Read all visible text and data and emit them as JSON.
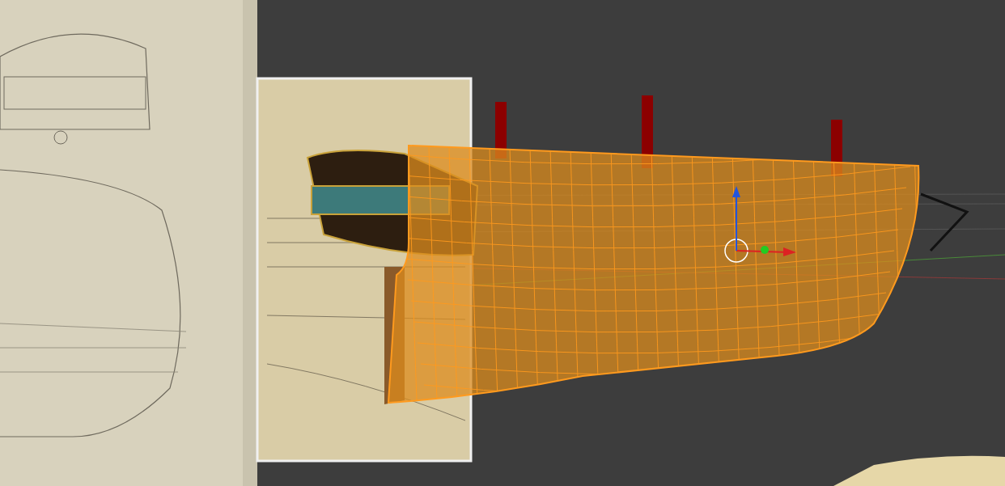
{
  "viewport": {
    "objects": [
      {
        "kind": "reference-image"
      },
      {
        "kind": "reference-sheet"
      },
      {
        "kind": "ship-model",
        "selected": true
      },
      {
        "kind": "floor-sheet"
      }
    ],
    "gizmo": {
      "kind": "translate"
    }
  }
}
